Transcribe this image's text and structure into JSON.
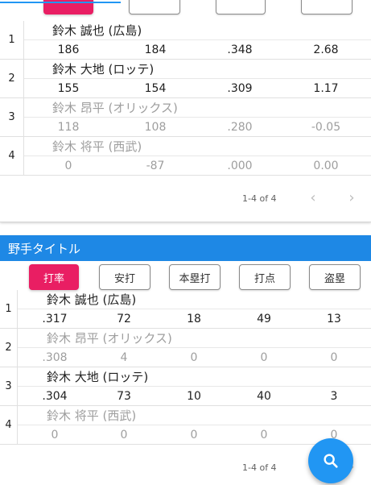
{
  "top_card": {
    "rows": [
      {
        "rank": "1",
        "name": "鈴木 誠也 (広島)",
        "stats": [
          "186",
          "184",
          ".348",
          "2.68"
        ],
        "faded": false
      },
      {
        "rank": "2",
        "name": "鈴木 大地 (ロッテ)",
        "stats": [
          "155",
          "154",
          ".309",
          "1.17"
        ],
        "faded": false
      },
      {
        "rank": "3",
        "name": "鈴木 昂平 (オリックス)",
        "stats": [
          "118",
          "108",
          ".280",
          "-0.05"
        ],
        "faded": true
      },
      {
        "rank": "4",
        "name": "鈴木 将平 (西武)",
        "stats": [
          "0",
          "-87",
          ".000",
          "0.00"
        ],
        "faded": true
      }
    ],
    "pager": {
      "range": "1-4 of 4",
      "prev": "‹",
      "next": "›"
    }
  },
  "bottom_card": {
    "title": "野手タイトル",
    "buttons": [
      {
        "label": "打率",
        "active": true
      },
      {
        "label": "安打",
        "active": false
      },
      {
        "label": "本塁打",
        "active": false
      },
      {
        "label": "打点",
        "active": false
      },
      {
        "label": "盗塁",
        "active": false
      }
    ],
    "rows": [
      {
        "rank": "1",
        "name": "鈴木 誠也 (広島)",
        "stats": [
          ".317",
          "72",
          "18",
          "49",
          "13"
        ],
        "faded": false
      },
      {
        "rank": "2",
        "name": "鈴木 昂平 (オリックス)",
        "stats": [
          ".308",
          "4",
          "0",
          "0",
          "0"
        ],
        "faded": true
      },
      {
        "rank": "3",
        "name": "鈴木 大地 (ロッテ)",
        "stats": [
          ".304",
          "73",
          "10",
          "40",
          "3"
        ],
        "faded": false
      },
      {
        "rank": "4",
        "name": "鈴木 将平 (西武)",
        "stats": [
          "0",
          "0",
          "0",
          "0",
          "0"
        ],
        "faded": true
      }
    ],
    "pager": {
      "range": "1-4 of 4",
      "next": "›"
    }
  },
  "fab": {
    "icon": "search-icon"
  },
  "colors": {
    "accent_blue": "#1e88e5",
    "active_pink": "#e91e63",
    "fab_blue": "#2196f3",
    "faded_text": "#9e9e9e"
  }
}
